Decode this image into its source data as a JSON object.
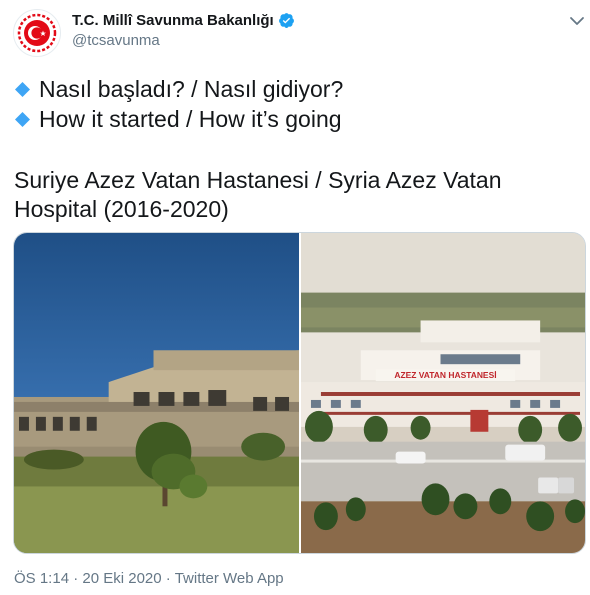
{
  "account": {
    "name": "T.C. Millî Savunma Bakanlığı",
    "handle": "@tcsavunma",
    "verified": true,
    "verified_color": "#1da1f2"
  },
  "tweet": {
    "lines": [
      {
        "icon": "blue-diamond-icon",
        "text": "Nasıl başladı?  / Nasıl gidiyor?"
      },
      {
        "icon": "blue-diamond-icon",
        "text": "How it started / How it’s going"
      }
    ],
    "title": "Suriye Azez Vatan Hastanesi / Syria Azez Vatan Hospital (2016-2020)"
  },
  "media": {
    "left_photo": "ruined building photo",
    "right_photo": "hospital aerial photo",
    "hospital_sign": "AZEZ VATAN HASTANESİ"
  },
  "meta": {
    "time": "ÖS 1:14",
    "separator1": "·",
    "date": "20 Eki 2020",
    "separator2": "·",
    "source": "Twitter Web App"
  },
  "colors": {
    "text": "#14171a",
    "secondary": "#657786",
    "accent": "#1da1f2",
    "diamond": "#3ea5f5",
    "logo_red": "#e30a17"
  }
}
